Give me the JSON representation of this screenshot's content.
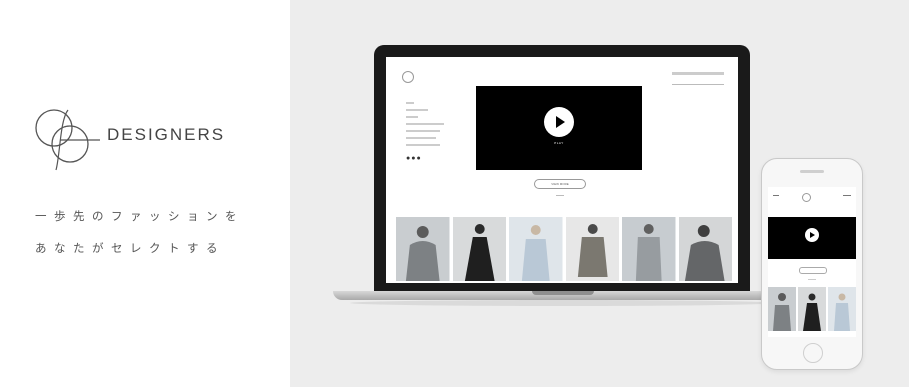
{
  "brand": {
    "name": "DESIGNERS",
    "tagline_line1": "一歩先のファッションを",
    "tagline_line2": "あなたがセレクトする"
  },
  "laptop_screen": {
    "video_play_label": "PLAY",
    "button_label": "VIEW MORE",
    "dots": "●●●"
  },
  "colors": {
    "background_right": "#ededed",
    "video_background": "#000000",
    "text": "#444444"
  }
}
